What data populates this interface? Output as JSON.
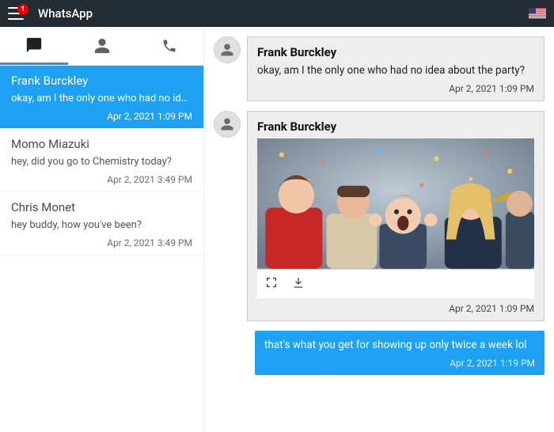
{
  "header": {
    "app_title": "WhatsApp",
    "badge_count": "1",
    "locale": "us"
  },
  "tabs": {
    "chat_icon": "message",
    "contacts_icon": "person",
    "calls_icon": "phone",
    "active": "chat"
  },
  "conversations": [
    {
      "name": "Frank Burckley",
      "snippet": "okay, am I the only one who had no ide…",
      "time": "Apr 2, 2021 1:09 PM",
      "selected": true
    },
    {
      "name": "Momo Miazuki",
      "snippet": "hey, did you go to Chemistry today?",
      "time": "Apr 2, 2021 3:49 PM",
      "selected": false
    },
    {
      "name": "Chris Monet",
      "snippet": "hey buddy, how you've been?",
      "time": "Apr 2, 2021 3:49 PM",
      "selected": false
    }
  ],
  "thread": {
    "messages": [
      {
        "type": "incoming_text",
        "sender": "Frank Burckley",
        "text": "okay, am I the only one who had no idea about the party?",
        "time": "Apr 2, 2021 1:09 PM"
      },
      {
        "type": "incoming_media",
        "sender": "Frank Burckley",
        "media_alt": "party photo with confetti",
        "time": "Apr 2, 2021 1:09 PM"
      },
      {
        "type": "outgoing_text",
        "text": "that's what you get for showing up only twice a week lol",
        "time": "Apr 2, 2021 1:19 PM"
      }
    ],
    "actions": {
      "expand": "expand-icon",
      "download": "download-icon"
    }
  }
}
